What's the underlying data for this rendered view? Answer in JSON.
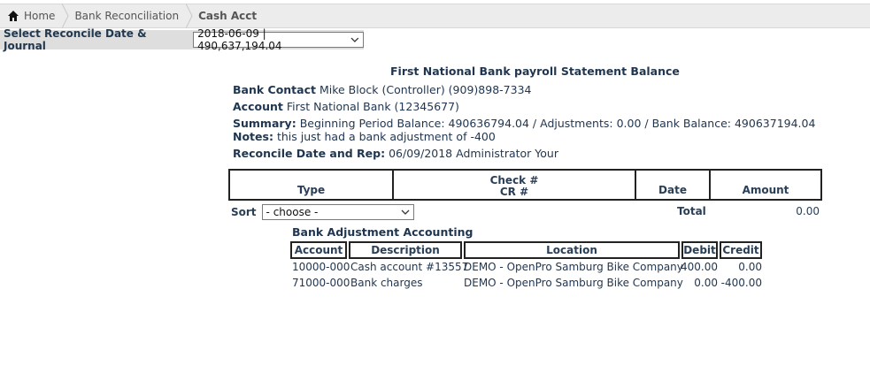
{
  "breadcrumb": {
    "home": "Home",
    "level1": "Bank Reconciliation",
    "current": "Cash Acct"
  },
  "selector": {
    "label": "Select Reconcile Date & Journal",
    "value": "2018-06-09 | 490,637,194.04"
  },
  "statement": {
    "title": "First National Bank payroll Statement Balance",
    "contact_label": "Bank Contact",
    "contact_value": "Mike Block (Controller) (909)898-7334",
    "account_label": "Account",
    "account_value": "First National Bank (12345677)",
    "summary_label": "Summary:",
    "summary_value": "Beginning Period Balance: 490636794.04 / Adjustments: 0.00 / Bank Balance: 490637194.04",
    "notes_label": "Notes:",
    "notes_value": "this just had a bank adjustment of -400",
    "reconcile_label": "Reconcile Date and Rep:",
    "reconcile_value": "06/09/2018 Administrator Your"
  },
  "main_table": {
    "col_type": "Type",
    "col_check_1": "Check #",
    "col_check_2": "CR #",
    "col_date": "Date",
    "col_amount": "Amount"
  },
  "sort": {
    "label": "Sort",
    "value": "- choose -"
  },
  "total": {
    "label": "Total",
    "value": "0.00"
  },
  "adjustments": {
    "title": "Bank Adjustment Accounting",
    "headers": [
      "Account",
      "Description",
      "Location",
      "Debit",
      "Credit"
    ],
    "rows": [
      {
        "account": "10000-000",
        "description": "Cash account #13557",
        "location": "DEMO - OpenPro Samburg Bike Company",
        "debit": "400.00",
        "credit": "0.00"
      },
      {
        "account": "71000-000",
        "description": "Bank charges",
        "location": "DEMO - OpenPro Samburg Bike Company",
        "debit": "0.00",
        "credit": "-400.00"
      }
    ]
  }
}
